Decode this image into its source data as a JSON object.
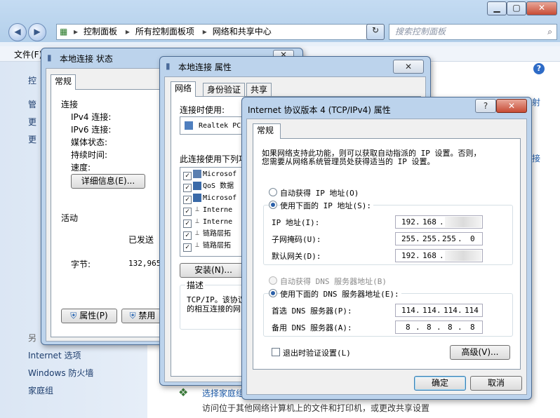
{
  "explorer": {
    "breadcrumb": [
      "控制面板",
      "所有控制面板项",
      "网络和共享中心"
    ],
    "search_placeholder": "搜索控制面板",
    "menu_file": "文件(F)",
    "left_items_partial": [
      "控",
      "管",
      "更",
      "更"
    ],
    "see_also_partial": "另",
    "left_links": [
      "Internet 选项",
      "Windows 防火墙",
      "家庭组"
    ],
    "content_link": "选择家庭组",
    "content_desc": "访问位于其他网络计算机上的文件和打印机，或更改共享设置",
    "right_partial_1": "射",
    "right_partial_2": "接"
  },
  "status_dialog": {
    "title": "本地连接 状态",
    "tab": "常规",
    "connection_header": "连接",
    "fields": [
      "IPv4 连接:",
      "IPv6 连接:",
      "媒体状态:",
      "持续时间:",
      "速度:"
    ],
    "details_button": "详细信息(E)...",
    "activity_header": "活动",
    "sent_label": "已发送",
    "bytes_label": "字节:",
    "bytes_value": "132,965,",
    "properties_button": "属性(P)",
    "disable_button": "禁用"
  },
  "props_dialog": {
    "title": "本地连接 属性",
    "tabs": [
      "网络",
      "身份验证",
      "共享"
    ],
    "connect_using_label": "连接时使用:",
    "adapter": "Realtek PC",
    "items_label": "此连接使用下列项",
    "items": [
      "Microsof",
      "QoS 数据",
      "Microsof",
      "Interne",
      "Interne",
      "链路层拓",
      "链路层拓"
    ],
    "install_button": "安装(N)...",
    "desc_header": "描述",
    "desc_text_1": "TCP/IP。该协议",
    "desc_text_2": "的相互连接的网"
  },
  "ipv4_dialog": {
    "title": "Internet 协议版本 4 (TCP/IPv4) 属性",
    "help_symbol": "?",
    "tab": "常规",
    "intro_line1": "如果网络支持此功能，则可以获取自动指派的 IP 设置。否则，",
    "intro_line2": "您需要从网络系统管理员处获得适当的 IP 设置。",
    "auto_ip": "自动获得 IP 地址(O)",
    "manual_ip": "使用下面的 IP 地址(S):",
    "ip_label": "IP 地址(I):",
    "ip_value": [
      "192",
      "168",
      ""
    ],
    "mask_label": "子网掩码(U):",
    "mask_value": [
      "255",
      "255",
      "255",
      "0"
    ],
    "gateway_label": "默认网关(D):",
    "gateway_value": [
      "192",
      "168",
      ""
    ],
    "auto_dns": "自动获得 DNS 服务器地址(B)",
    "manual_dns": "使用下面的 DNS 服务器地址(E):",
    "pref_dns_label": "首选 DNS 服务器(P):",
    "pref_dns_value": [
      "114",
      "114",
      "114",
      "114"
    ],
    "alt_dns_label": "备用 DNS 服务器(A):",
    "alt_dns_value": [
      "8",
      "8",
      "8",
      "8"
    ],
    "validate_label": "退出时验证设置(L)",
    "advanced_button": "高级(V)...",
    "ok_button": "确定",
    "cancel_button": "取消"
  }
}
